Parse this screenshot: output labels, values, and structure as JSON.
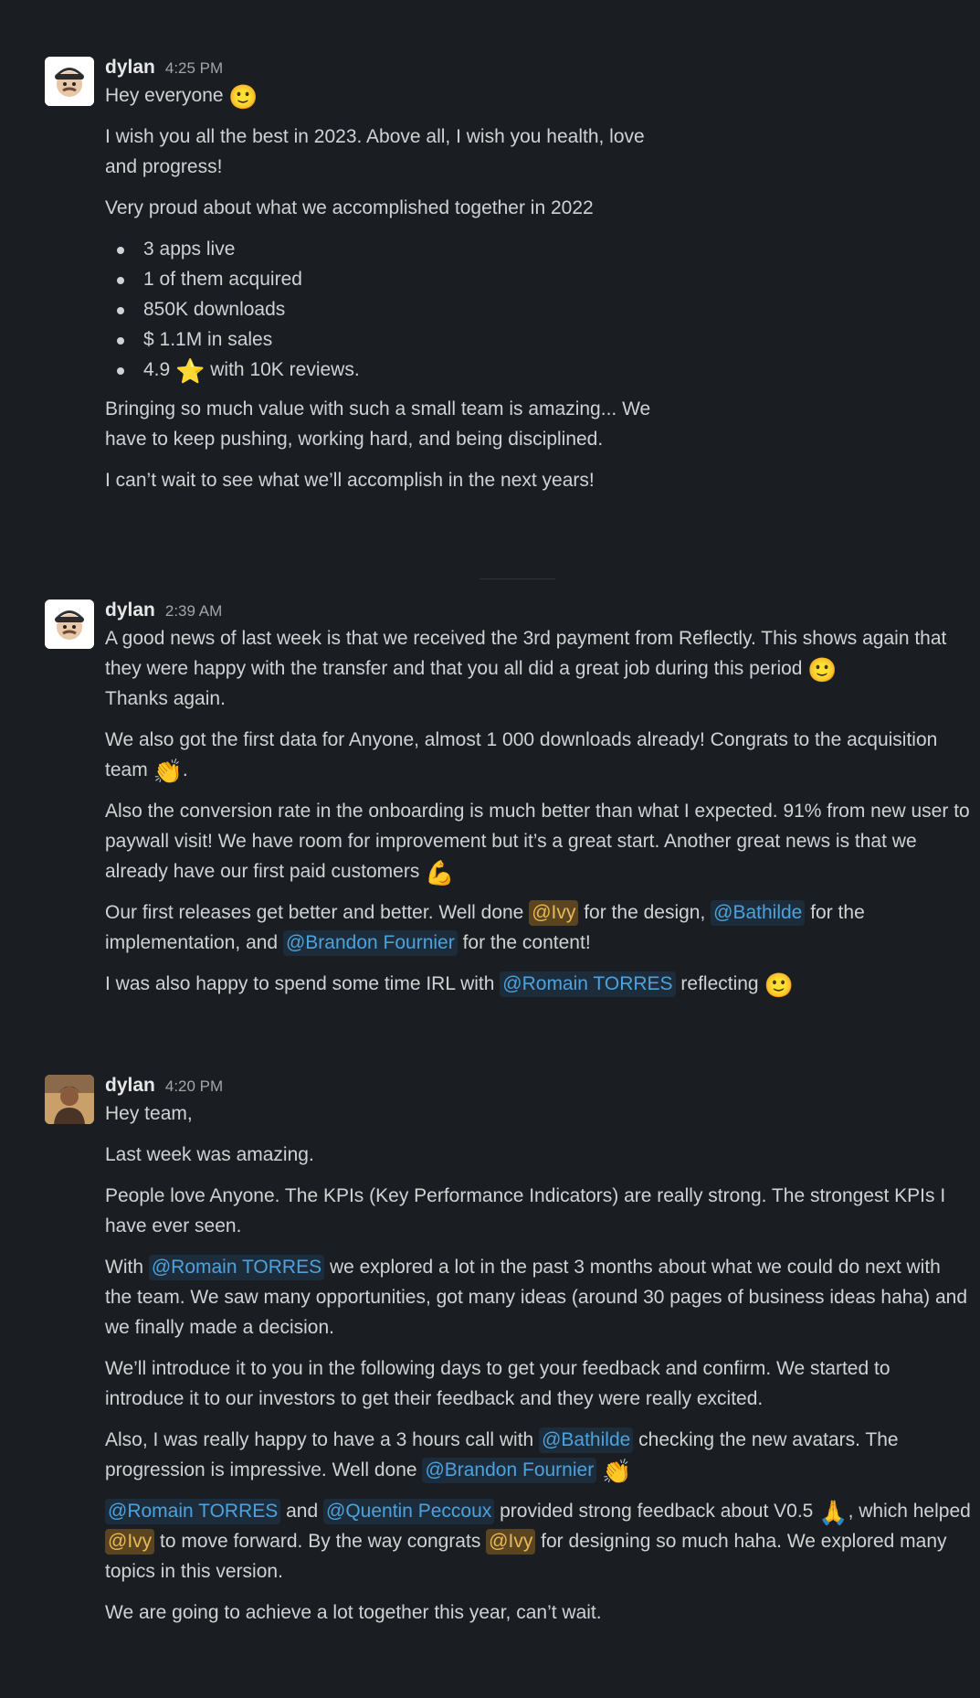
{
  "messages": [
    {
      "author": "dylan",
      "time": "4:25 PM",
      "greeting": "Hey everyone",
      "line1": "I wish you all the best in 2023. Above all, I wish you health, love and progress!",
      "line2": "Very proud about what we accomplished together in 2022",
      "bullets": [
        "3 apps live",
        "1 of them acquired",
        "850K downloads",
        "$ 1.1M in sales"
      ],
      "bullet5_a": "4.9",
      "bullet5_b": "with 10K reviews.",
      "line3": "Bringing so much value with such a small team is amazing... We have to keep pushing, working hard, and being disciplined.",
      "line4": "I can’t wait to see what we’ll accomplish in the next years!"
    },
    {
      "author": "dylan",
      "time": "2:39 AM",
      "p1_a": "A good news of last week is that we received the 3rd payment from Reflectly. This shows again that they were happy with the transfer and that you all did a great job during this period",
      "p1_b": "Thanks again.",
      "p2_a": "We also got the first data for Anyone, almost 1 000 downloads already! Congrats to the acquisition team",
      "p2_b": ".",
      "p3": "Also the conversion rate in the onboarding is much better than what I expected. 91% from new user to paywall visit! We have room for improvement but it’s a great start. Another great news is that we already have our first paid customers",
      "p4_a": "Our first releases get better and better. Well done",
      "p4_m1": "@Ivy",
      "p4_b": "for the design,",
      "p4_m2": "@Bathilde",
      "p4_c": "for the implementation, and",
      "p4_m3": "@Brandon Fournier",
      "p4_d": "for the content!",
      "p5_a": "I was also happy to spend some time IRL with",
      "p5_m1": "@Romain TORRES",
      "p5_b": "reflecting"
    },
    {
      "author": "dylan",
      "time": "4:20 PM",
      "p1": "Hey team,",
      "p2": "Last week was amazing.",
      "p3": "People love Anyone. The KPIs (Key Performance Indicators) are really strong. The strongest KPIs I have ever seen.",
      "p4_a": "With",
      "p4_m1": "@Romain TORRES",
      "p4_b": "we explored a lot in the past 3 months about what we could do next with the team. We saw many opportunities, got many ideas (around 30 pages of business ideas haha) and we finally made a decision.",
      "p5": "We’ll introduce it to you in the following days to get your feedback and confirm. We started to introduce it to our investors to get their feedback and they were really excited.",
      "p6_a": "Also, I was really happy to have a 3 hours call with",
      "p6_m1": "@Bathilde",
      "p6_b": "checking the new avatars. The progression is impressive. Well done",
      "p6_m2": "@Brandon Fournier",
      "p7_m1": "@Romain TORRES",
      "p7_a": "and",
      "p7_m2": "@Quentin Peccoux",
      "p7_b": "provided strong feedback about V0.5",
      "p7_c": ", which helped",
      "p7_m3": "@Ivy",
      "p7_d": "to move forward. By the way congrats",
      "p7_m4": "@Ivy",
      "p7_e": "for designing so much haha. We explored many topics in this version.",
      "p8": "We are going to achieve a lot together this year, can’t wait."
    }
  ],
  "emoji": {
    "smile": "🙂",
    "star": "⭐",
    "clap": "👏",
    "muscle": "💪",
    "pray": "🙏"
  },
  "colors": {
    "background": "#1a1d21",
    "text": "#d1d2d3",
    "mention_bg": "#1d2c3b",
    "mention_text": "#4ea2dc",
    "self_mention_bg": "#5b4420",
    "self_mention_text": "#e8b85a"
  }
}
